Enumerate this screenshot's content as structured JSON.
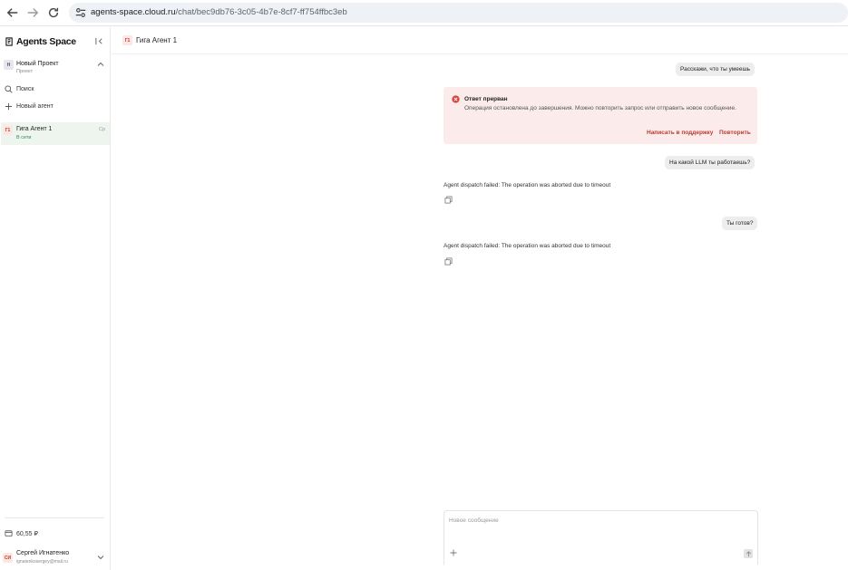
{
  "browser": {
    "url_host": "agents-space.cloud.ru",
    "url_path": "/chat/bec9db76-3c05-4b7e-8cf7-ff754ffbc3eb"
  },
  "sidebar": {
    "brand": "Agents Space",
    "project": {
      "avatar": "Н",
      "name": "Новый Проект",
      "subtitle": "Проект"
    },
    "search_label": "Поиск",
    "new_agent_label": "Новый агент",
    "agent": {
      "avatar": "Г1",
      "name": "Гига Агент 1",
      "status": "В сети",
      "day": "Ср"
    },
    "balance": "60,55 ₽",
    "user": {
      "avatar": "СИ",
      "name": "Сергей Игнатенко",
      "email": "ignatenkosergey@mail.ru"
    }
  },
  "header": {
    "avatar": "Г1",
    "title": "Гига Агент 1"
  },
  "chat": {
    "user_msg_1": "Расскажи, что ты умеешь",
    "error": {
      "title": "Ответ прерван",
      "description": "Операция остановлена до завершения. Можно повторить запрос или отправить новое сообщение.",
      "support_link": "Написать в поддержку",
      "retry_link": "Повторить"
    },
    "user_msg_2": "На какой LLM ты работаешь?",
    "agent_msg_1": "Agent dispatch failed: The operation was aborted due to timeout",
    "user_msg_3": "Ты готов?",
    "agent_msg_2": "Agent dispatch failed: The operation was aborted due to timeout"
  },
  "composer": {
    "placeholder": "Новое сообщение"
  },
  "colors": {
    "accent_red": "#b83b32",
    "online_green": "#2e8b57",
    "error_bg": "#fbeceb"
  }
}
